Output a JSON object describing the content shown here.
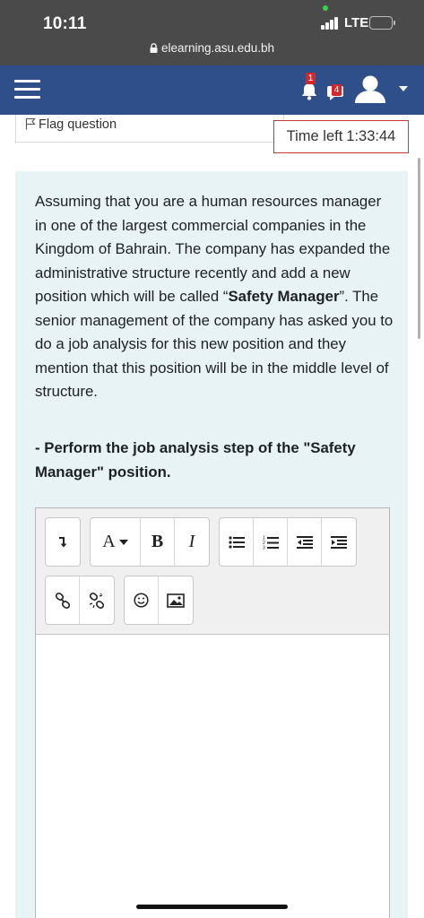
{
  "status_bar": {
    "time": "10:11",
    "network": "LTE",
    "battery_color": "#f5d400",
    "url": "elearning.asu.edu.bh"
  },
  "navbar": {
    "background": "#2e4f8a",
    "notifications_count": "1",
    "messages_count": "4"
  },
  "question": {
    "flag_label": "Flag question",
    "timer_label": "Time left",
    "timer_value": "1:33:44",
    "text_part1": "Assuming that you are a human resources manager in one of the largest commercial companies in the Kingdom of Bahrain. The company has expanded the administrative structure recently and add a new position which will be called “",
    "text_bold": "Safety Manager",
    "text_part2": "”. The senior management of the company has asked you to do a job analysis for this new position and they mention that this position will be in the middle level of structure.",
    "task": "- Perform the job analysis step of the \"Safety Manager\" position."
  },
  "editor": {
    "toolbar_row1": [
      "show-more-buttons-icon",
      "font-style-icon",
      "bold-icon",
      "italic-icon",
      "unordered-list-icon",
      "ordered-list-icon",
      "outdent-icon",
      "indent-icon"
    ],
    "toolbar_row2": [
      "link-icon",
      "unlink-icon",
      "emoji-icon",
      "image-icon"
    ],
    "font_label": "A",
    "bold_label": "B",
    "italic_label": "I",
    "content": ""
  }
}
